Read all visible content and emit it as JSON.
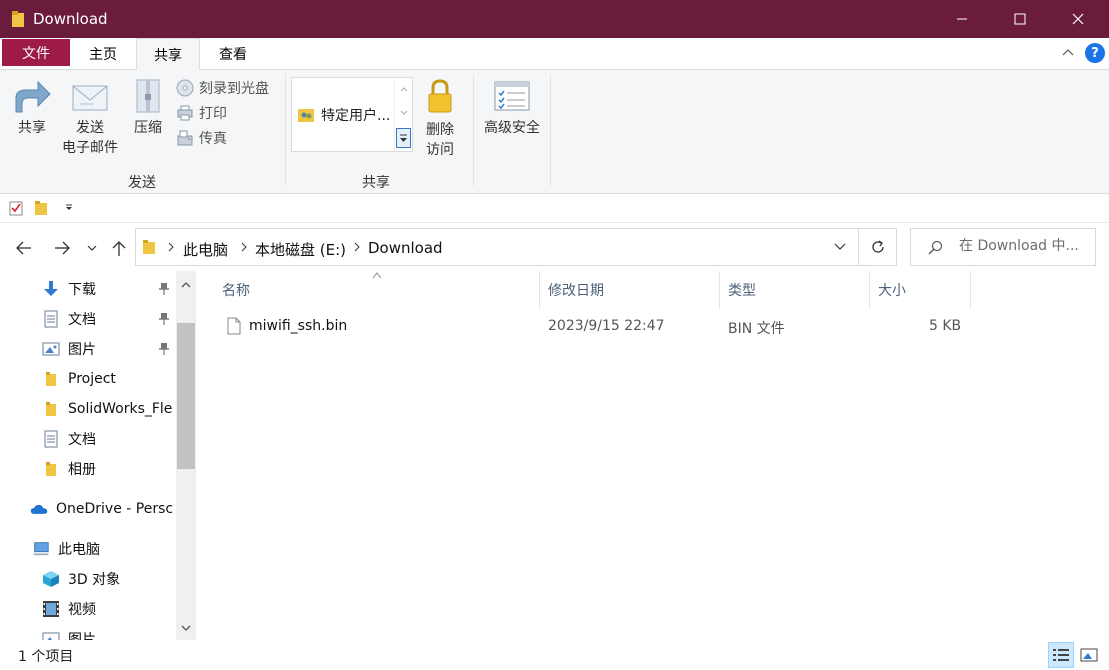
{
  "window": {
    "title": "Download",
    "colors": {
      "titlebar": "#6b1c3d",
      "file_tab": "#9e1b47",
      "accent": "#1a73e8"
    }
  },
  "ribbon": {
    "tabs": [
      "文件",
      "主页",
      "共享",
      "查看"
    ],
    "active_tab": "共享",
    "send_group": {
      "label": "发送",
      "share": "共享",
      "email_line1": "发送",
      "email_line2": "电子邮件",
      "zip": "压缩",
      "burn": "刻录到光盘",
      "print": "打印",
      "fax": "传真"
    },
    "share_group": {
      "label": "共享",
      "gallery_item": "特定用户...",
      "remove_line1": "删除",
      "remove_line2": "访问"
    },
    "advanced_security": "高级安全"
  },
  "address": {
    "crumbs": [
      "此电脑",
      "本地磁盘 (E:)",
      "Download"
    ]
  },
  "search": {
    "placeholder": "在 Download 中..."
  },
  "nav": {
    "items": [
      {
        "label": "下载",
        "icon": "download-arrow-icon",
        "pinned": true
      },
      {
        "label": "文档",
        "icon": "document-icon",
        "pinned": true
      },
      {
        "label": "图片",
        "icon": "pictures-icon",
        "pinned": true
      },
      {
        "label": "Project",
        "icon": "folder-icon",
        "pinned": false
      },
      {
        "label": "SolidWorks_Fle",
        "icon": "folder-icon",
        "pinned": false
      },
      {
        "label": "文档",
        "icon": "document-icon",
        "pinned": false
      },
      {
        "label": "相册",
        "icon": "folder-icon",
        "pinned": false
      },
      {
        "label": "OneDrive - Persc",
        "icon": "onedrive-cloud-icon",
        "pinned": false
      },
      {
        "label": "此电脑",
        "icon": "computer-icon",
        "pinned": false
      },
      {
        "label": "3D 对象",
        "icon": "3d-objects-icon",
        "pinned": false
      },
      {
        "label": "视频",
        "icon": "video-icon",
        "pinned": false
      },
      {
        "label": "图片",
        "icon": "pictures-icon",
        "pinned": false
      }
    ]
  },
  "columns": [
    "名称",
    "修改日期",
    "类型",
    "大小"
  ],
  "files": [
    {
      "name": "miwifi_ssh.bin",
      "modified": "2023/9/15 22:47",
      "type": "BIN 文件",
      "size": "5 KB"
    }
  ],
  "status": {
    "count": "1 个项目"
  }
}
